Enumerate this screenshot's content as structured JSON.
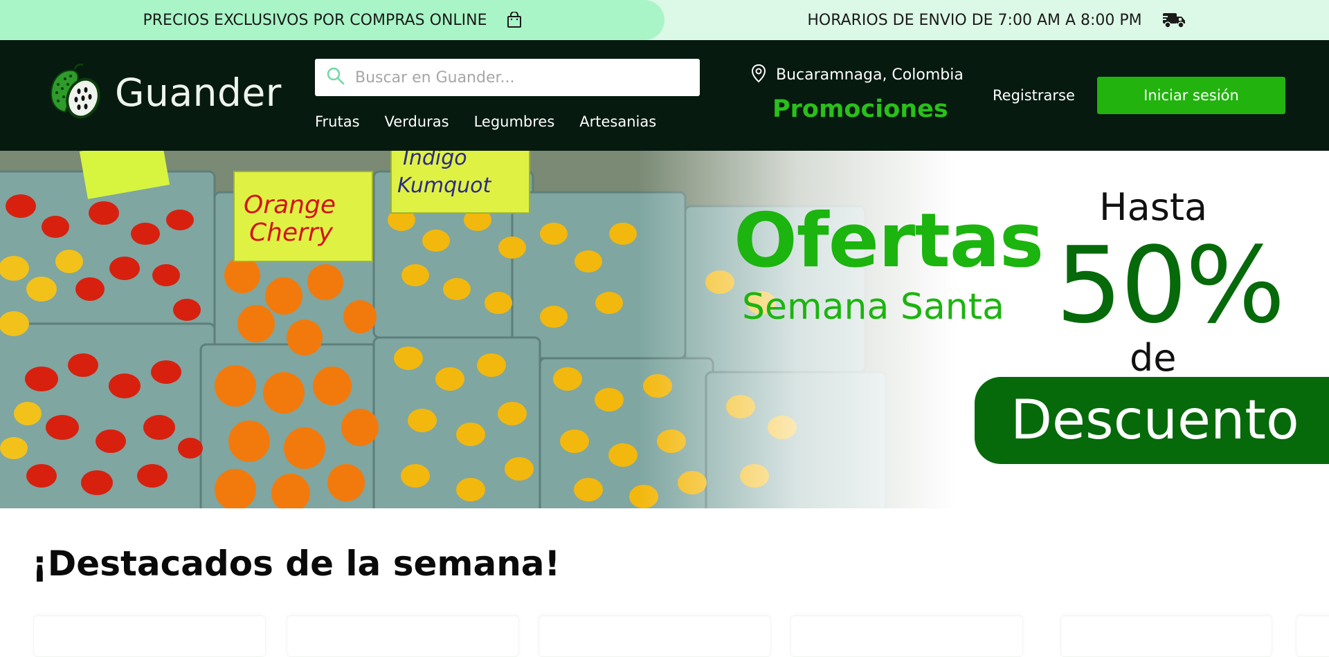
{
  "topbar": {
    "left_text": "PRECIOS EXCLUSIVOS POR COMPRAS ONLINE",
    "left_icon": "shopping-bag-icon",
    "right_text": "HORARIOS DE ENVIO DE 7:00 AM A 8:00 PM",
    "right_icon": "delivery-truck-icon"
  },
  "header": {
    "brand": "Guander",
    "search_placeholder": "Buscar en Guander...",
    "nav": [
      "Frutas",
      "Verduras",
      "Legumbres",
      "Artesanias"
    ],
    "location": "Bucaramnaga, Colombia",
    "promotions": "Promociones",
    "register": "Registrarse",
    "login": "Iniciar sesión"
  },
  "hero": {
    "title": "Ofertas",
    "subtitle": "Semana Santa",
    "hasta": "Hasta",
    "percent": "50%",
    "de": "de",
    "discount": "Descuento",
    "sign_1": "Orange Cherry",
    "sign_2": "Indigo Kumquot"
  },
  "featured": {
    "title": "¡Destacados de la semana!"
  },
  "colors": {
    "topbar_left": "#a9f5c7",
    "topbar_right": "#dcf8e6",
    "header_bg": "#061a10",
    "brand_green": "#1cb40f",
    "dark_green": "#066a0a",
    "login_button": "#22b30f"
  }
}
